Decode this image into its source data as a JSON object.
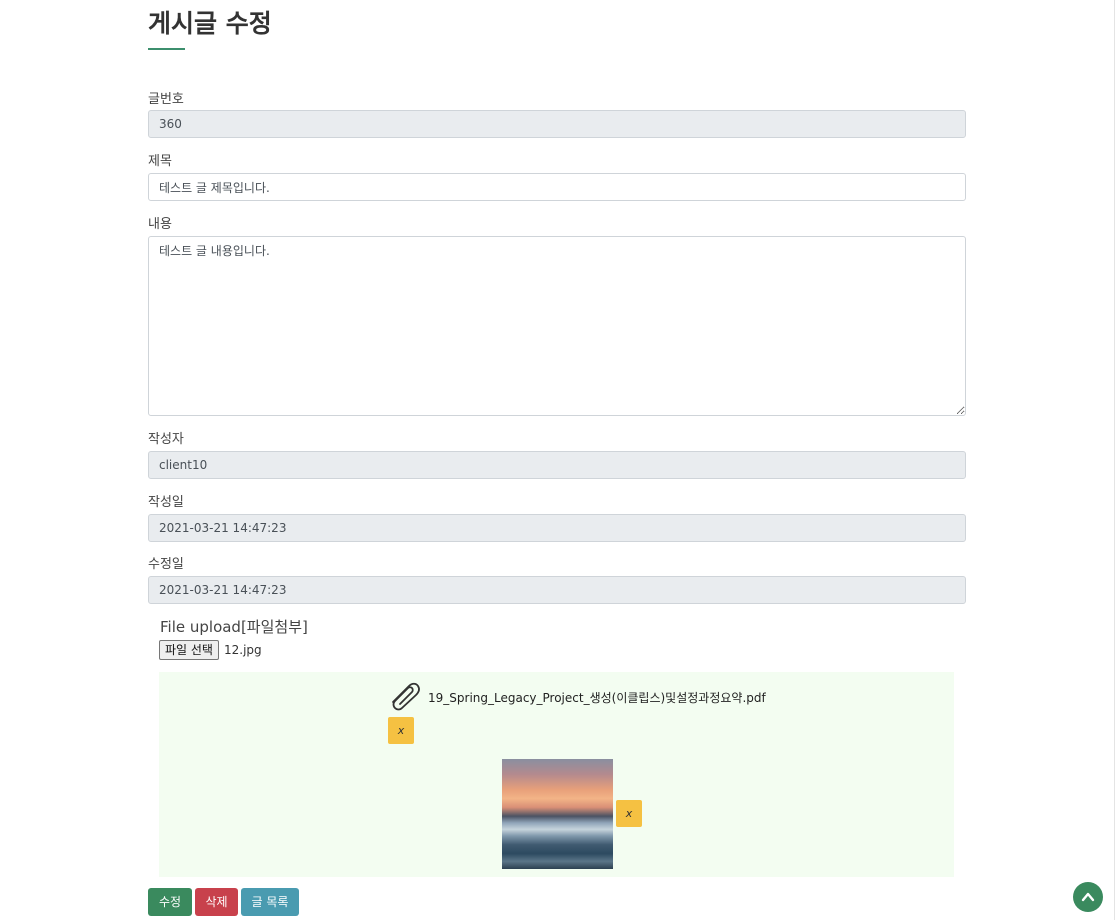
{
  "page": {
    "title": "게시글 수정"
  },
  "form": {
    "bno": {
      "label": "글번호",
      "value": "360"
    },
    "title": {
      "label": "제목",
      "value": "테스트 글 제목입니다."
    },
    "content": {
      "label": "내용",
      "value": "테스트 글 내용입니다."
    },
    "writer": {
      "label": "작성자",
      "value": "client10"
    },
    "regdate": {
      "label": "작성일",
      "value": "2021-03-21 14:47:23"
    },
    "updatedate": {
      "label": "수정일",
      "value": "2021-03-21 14:47:23"
    }
  },
  "upload": {
    "section_title": "File upload[파일첨부]",
    "choose_button_label": "파일 선택",
    "chosen_file_name": "12.jpg",
    "attachments": [
      {
        "type": "document",
        "icon": "paperclip-icon",
        "file_name": "19_Spring_Legacy_Project_생성(이클립스)및설정과정요약.pdf",
        "delete_label": "x"
      },
      {
        "type": "image",
        "delete_label": "x"
      }
    ]
  },
  "actions": {
    "modify_label": "수정",
    "delete_label": "삭제",
    "list_label": "글 목록"
  },
  "colors": {
    "accent": "#3a8a5e",
    "danger": "#c8414c",
    "info": "#4a9bb0",
    "warning": "#f5c142",
    "panel_bg": "#f3fdf1"
  },
  "scroll_top_icon": "chevron-up-icon"
}
